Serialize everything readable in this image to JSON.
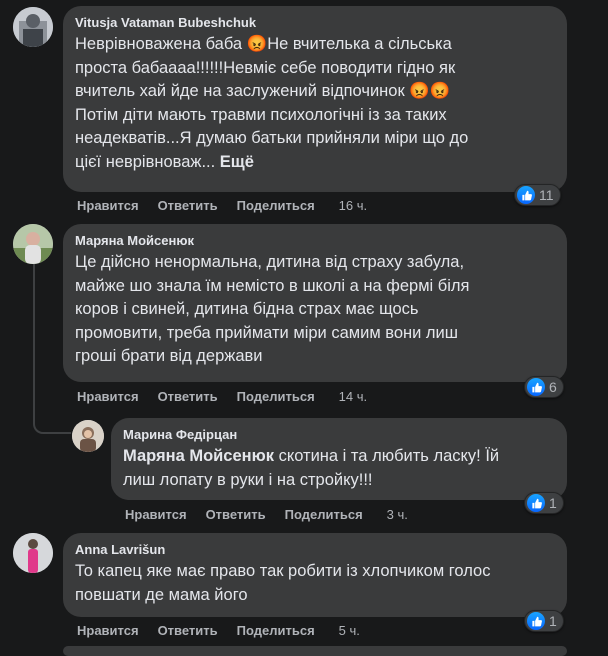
{
  "comments": [
    {
      "author": "Vitusja Vataman Bubeshchuk",
      "text": "Неврівноважена баба 😡Не вчителька а сільська\nпроста бабаааа!!!!!!Невміє себе поводити гідно як\nвчитель хай йде на заслужений відпочинок 😡😡\nПотім діти мають травми психологічні із за таких\nнеадекватів...Я думаю батьки прийняли міри що до\nцієї неврівноваж... ",
      "more": "Ещё",
      "actions": {
        "like": "Нравится",
        "reply": "Ответить",
        "share": "Поделиться",
        "time": "16 ч."
      },
      "reactions": "11"
    },
    {
      "author": "Маряна Мойсенюк",
      "text": "Це дійсно ненормальна, дитина від страху забула,\nмайже шо знала їм немісто в школі а на фермі біля\nкоров і свиней, дитина бідна страх має щось\nпромовити, треба приймати міри самим вони лиш\nгроші брати від держави",
      "actions": {
        "like": "Нравится",
        "reply": "Ответить",
        "share": "Поделиться",
        "time": "14 ч."
      },
      "reactions": "6"
    },
    {
      "author": "Марина Федірцан",
      "mention": "Маряна Мойсенюк",
      "text": " скотина і та любить ласку! Їй\nлиш лопату в руки і на стройку!!!",
      "actions": {
        "like": "Нравится",
        "reply": "Ответить",
        "share": "Поделиться",
        "time": "3 ч."
      },
      "reactions": "1"
    },
    {
      "author": "Anna Lavrišun",
      "text": "То капец яке має право так робити із хлопчиком голос\nповшати де мама його",
      "actions": {
        "like": "Нравится",
        "reply": "Ответить",
        "share": "Поделиться",
        "time": "5 ч."
      },
      "reactions": "1"
    }
  ],
  "colors": {
    "background": "#18191a",
    "bubble": "#3a3b3c",
    "text": "#e4e6eb",
    "muted": "#b0b3b8",
    "like": "#0866ff"
  }
}
